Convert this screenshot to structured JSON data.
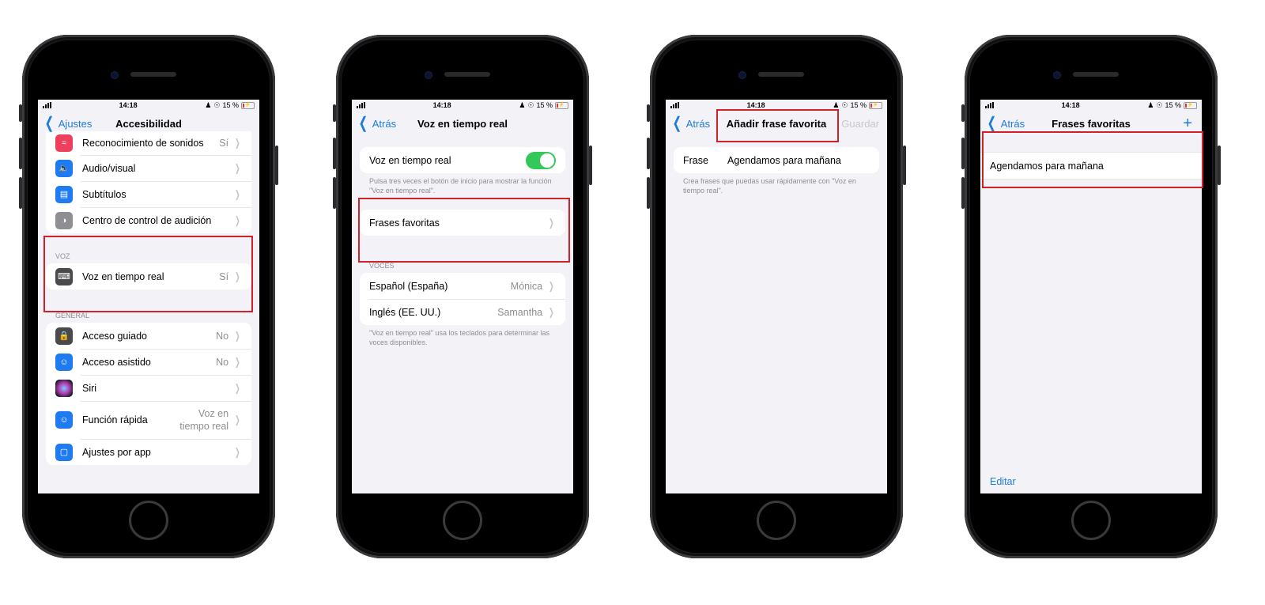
{
  "status_bar": {
    "time": "14:18",
    "battery": "15 %"
  },
  "screen1": {
    "nav": {
      "back": "Ajustes",
      "title": "Accesibilidad"
    },
    "top_items": [
      {
        "label": "Reconocimiento de sonidos",
        "value": "Sí",
        "icon": "sound-recognition-icon",
        "color": "#ee3f5d"
      },
      {
        "label": "Audio/visual",
        "value": "",
        "icon": "audio-visual-icon",
        "color": "#1e7bf2"
      },
      {
        "label": "Subtítulos",
        "value": "",
        "icon": "subtitles-icon",
        "color": "#1e7bf2"
      },
      {
        "label": "Centro de control de audición",
        "value": "",
        "icon": "hearing-control-icon",
        "color": "#8e8e93"
      }
    ],
    "voz_header": "VOZ",
    "voz_item": {
      "label": "Voz en tiempo real",
      "value": "Sí",
      "icon": "keyboard-speech-icon",
      "color": "#4a4a4c"
    },
    "general_header": "GENERAL",
    "general_items": [
      {
        "label": "Acceso guiado",
        "value": "No",
        "icon": "lock-icon",
        "color": "#4a4a4c"
      },
      {
        "label": "Acceso asistido",
        "value": "No",
        "icon": "accessibility-icon",
        "color": "#1e7bf2"
      },
      {
        "label": "Siri",
        "value": "",
        "icon": "siri-icon",
        "color": "#3a2a4a"
      },
      {
        "label": "Función rápida",
        "value": "Voz en tiempo real",
        "icon": "accessibility-shortcut-icon",
        "color": "#1e7bf2"
      },
      {
        "label": "Ajustes por app",
        "value": "",
        "icon": "per-app-settings-icon",
        "color": "#1e7bf2"
      }
    ]
  },
  "screen2": {
    "nav": {
      "back": "Atrás",
      "title": "Voz en tiempo real"
    },
    "toggle_label": "Voz en tiempo real",
    "toggle_on": true,
    "toggle_footer": "Pulsa tres veces el botón de inicio para mostrar la función \"Voz en tiempo real\".",
    "favorites_label": "Frases favoritas",
    "voices_header": "VOCES",
    "voices": [
      {
        "label": "Español (España)",
        "value": "Mónica"
      },
      {
        "label": "Inglés (EE. UU.)",
        "value": "Samantha"
      }
    ],
    "voices_footer": "\"Voz en tiempo real\" usa los teclados para determinar las voces disponibles."
  },
  "screen3": {
    "nav": {
      "back": "Atrás",
      "title": "Añadir frase favorita",
      "save": "Guardar"
    },
    "field_label": "Frase",
    "field_value": "Agendamos para mañana",
    "footer": "Crea frases que puedas usar rápidamente con \"Voz en tiempo real\"."
  },
  "screen4": {
    "nav": {
      "back": "Atrás",
      "title": "Frases favoritas",
      "add": "+"
    },
    "phrases": [
      "Agendamos para mañana"
    ],
    "edit": "Editar"
  },
  "colors": {
    "accent": "#1e7bdc",
    "highlight": "#d0202a",
    "toggle_on": "#34c759"
  }
}
